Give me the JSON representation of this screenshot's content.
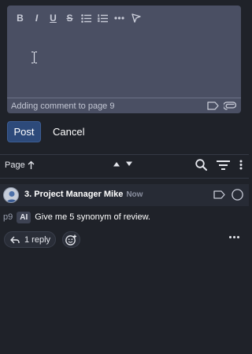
{
  "editor": {
    "toolbar": {
      "bold": "B",
      "italic": "I",
      "underline": "U",
      "strikethrough": "S"
    },
    "footer_note": "Adding comment to page 9"
  },
  "actions": {
    "post_label": "Post",
    "cancel_label": "Cancel"
  },
  "sort_bar": {
    "label": "Page"
  },
  "comment": {
    "author": "3. Project Manager Mike",
    "time": "Now",
    "page_ref": "p9",
    "badge": "AI",
    "text": "Give me 5 synonym of review.",
    "reply_label": "1 reply"
  },
  "colors": {
    "background": "#1f2229",
    "editor_bg": "#4a4f63",
    "post_button": "#2d4a7a"
  }
}
